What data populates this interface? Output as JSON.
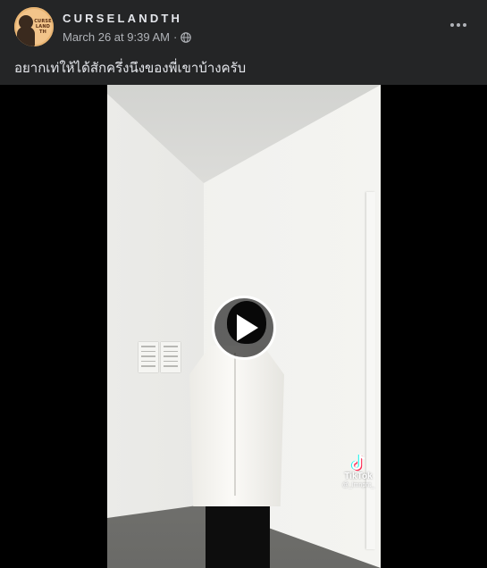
{
  "post": {
    "page_name": "CURSELANDTH",
    "avatar_text": "CURSE LAND TH",
    "date": "March 26 at 9:39 AM",
    "separator": "·",
    "audience_icon": "globe-icon",
    "more_icon": "more-options-icon",
    "caption": "อยากเท่ให้ได้สักครึ่งนึงของพี่เขาบ้างครับ"
  },
  "video": {
    "play_icon": "play-icon",
    "watermark": {
      "icon": "tiktok-icon",
      "label": "TikTok",
      "handle": "@_lmnpnt_"
    }
  },
  "colors": {
    "background": "#242526",
    "primary_text": "#e4e6eb",
    "secondary_text": "#b0b3b8",
    "video_background": "#000000",
    "avatar_background": "#f2c48a"
  }
}
